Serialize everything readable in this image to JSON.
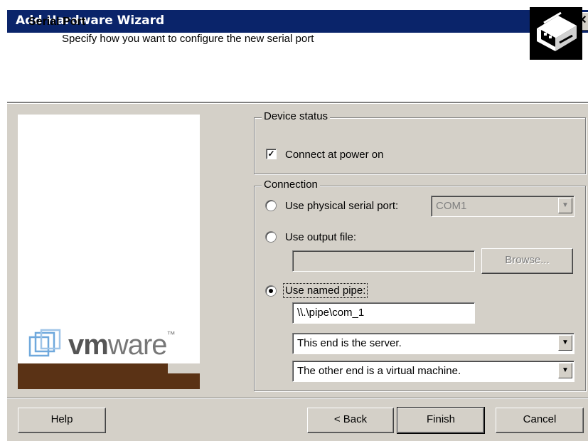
{
  "window": {
    "title": "Add Hardware Wizard",
    "close_glyph": "✕"
  },
  "header": {
    "title": "Serial Port",
    "subtitle": "Specify how you want to configure the new serial port",
    "icon": "serial-port-icon"
  },
  "logo": {
    "brand_bold": "vm",
    "brand_light": "ware",
    "trademark": "™"
  },
  "device_status": {
    "legend": "Device status",
    "connect_at_power_on": {
      "label": "Connect at power on",
      "checked": true
    }
  },
  "connection": {
    "legend": "Connection",
    "physical_port": {
      "label": "Use physical serial port:",
      "selected": false,
      "value": "COM1",
      "enabled": false
    },
    "output_file": {
      "label": "Use output file:",
      "selected": false,
      "value": "",
      "browse_label": "Browse..."
    },
    "named_pipe": {
      "label": "Use named pipe:",
      "selected": true,
      "pipe_name": "\\\\.\\pipe\\com_1",
      "end_role": "This end is the server.",
      "other_end": "The other end is a virtual machine."
    }
  },
  "footer": {
    "help_label": "Help",
    "back_label": "< Back",
    "finish_label": "Finish",
    "cancel_label": "Cancel"
  },
  "colors": {
    "titlebar": "#0a246a",
    "dialog": "#d4d0c8",
    "vm_bar": "#5a3215"
  }
}
